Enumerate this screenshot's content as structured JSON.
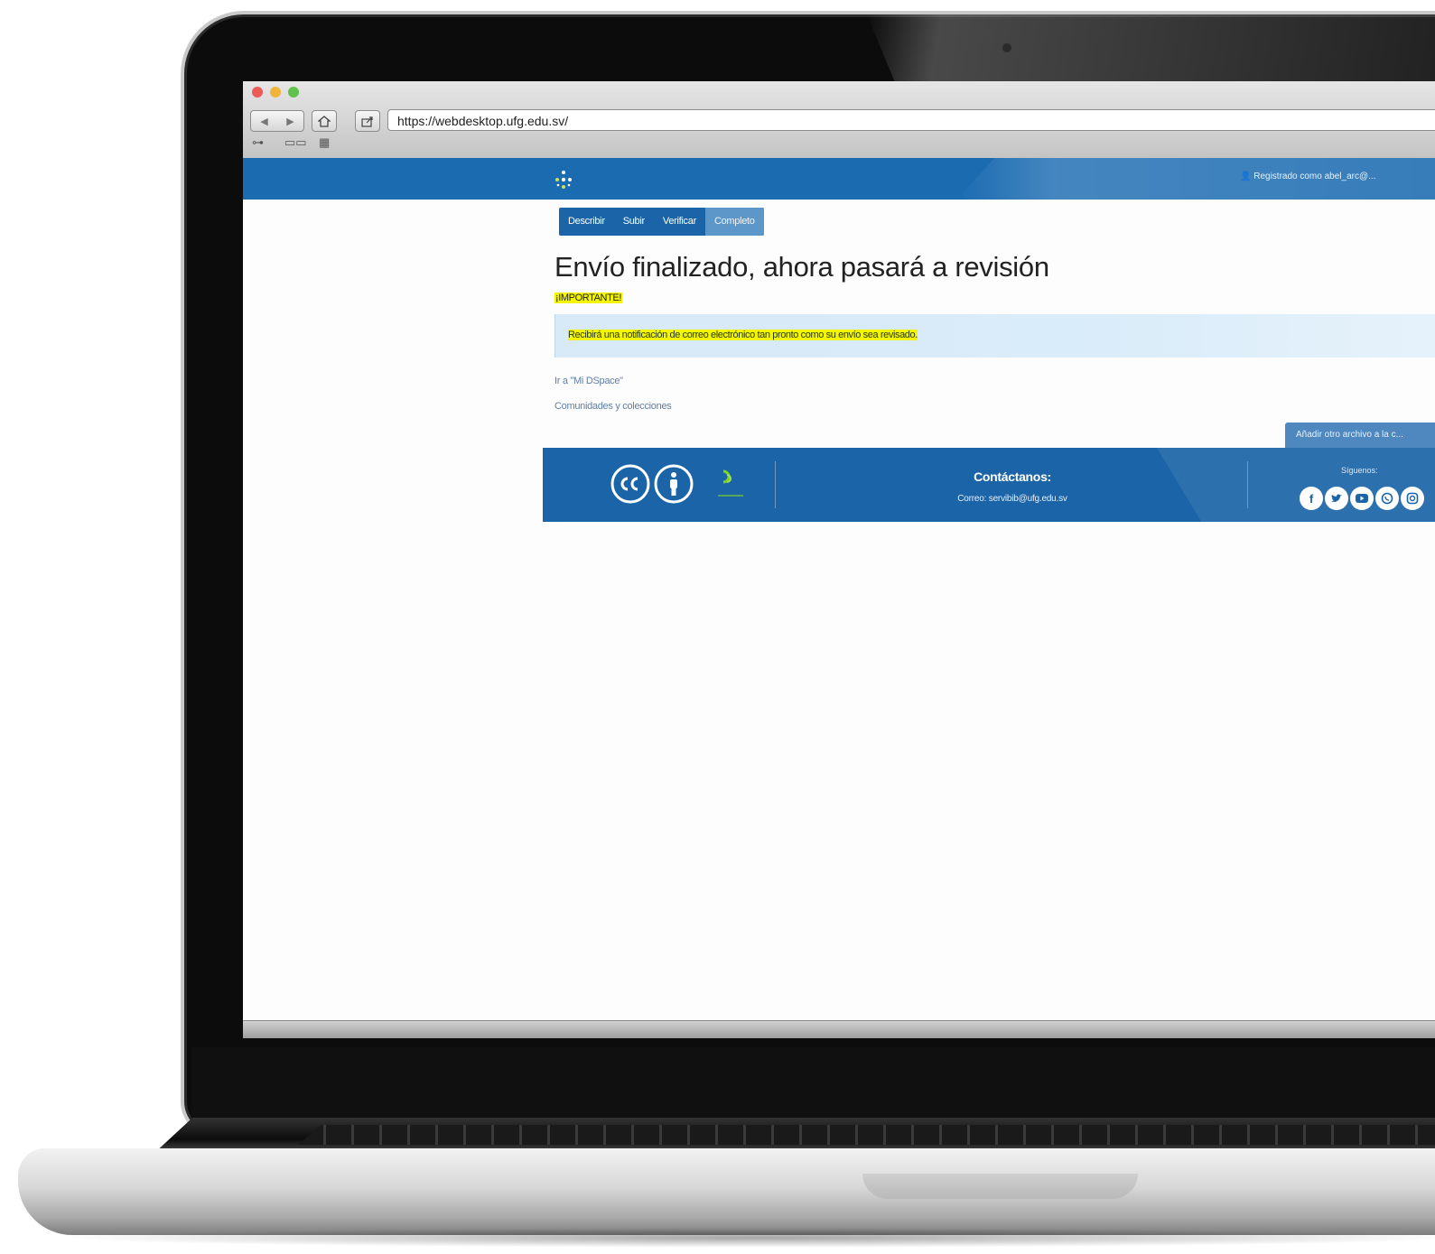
{
  "browser": {
    "url": "https://webdesktop.ufg.edu.sv/",
    "nav_back": "◀",
    "nav_forward": "▶",
    "home_icon": "home-icon",
    "share_icon": "share-icon"
  },
  "header": {
    "user_text": "👤 Registrado como abel_arc@..."
  },
  "steps": [
    "Describir",
    "Subir",
    "Verificar",
    "Completo"
  ],
  "main": {
    "title": "Envío finalizado, ahora pasará a revisión",
    "important_label": "¡IMPORTANTE!",
    "notice": "Recibirá una notificación de correo electrónico tan pronto como su envío sea revisado.",
    "link_mydspace": "Ir a \"Mi DSpace\"",
    "link_communities": "Comunidades y colecciones",
    "add_file": "Añadir otro archivo a la c..."
  },
  "footer": {
    "contact_heading": "Contáctanos:",
    "contact_email": "Correo: servibib@ufg.edu.sv",
    "follow_label": "Síguenos:",
    "social_icons": [
      "facebook-icon",
      "twitter-icon",
      "youtube-icon",
      "whatsapp-icon",
      "instagram-icon"
    ]
  },
  "colors": {
    "primary_blue": "#1b6bb1",
    "highlight_yellow": "#f4f600",
    "alert_bg": "#d8e9f7"
  }
}
